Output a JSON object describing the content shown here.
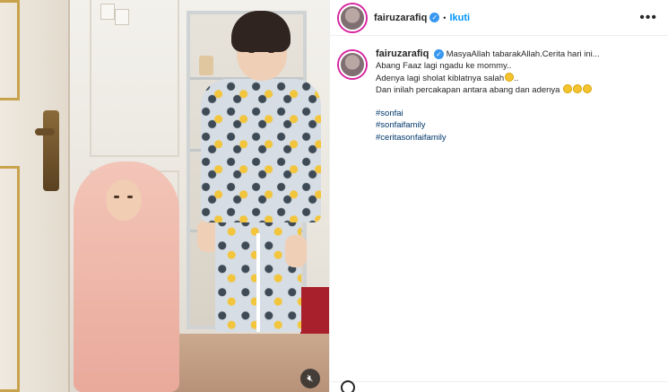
{
  "post": {
    "username": "fairuzarafiq",
    "separator": "•",
    "follow_label": "Ikuti",
    "more_label": "•••",
    "caption": {
      "username": "fairuzarafiq",
      "lines": [
        "MasyaAllah tabarakAllah.Cerita hari ini...",
        "Abang Faaz lagi ngadu ke mommy..",
        "Adenya lagi sholat kiblatnya salah",
        "Dan inilah percakapan antara abang dan adenya"
      ],
      "line3_suffix": "..",
      "hashtags": [
        "#sonfai",
        "#sonfaifamily",
        "#ceritasonfaifamily"
      ]
    }
  },
  "icons": {
    "verified": "verified-badge-icon",
    "more": "more-options-icon",
    "mute": "mute-icon",
    "like": "heart-icon"
  },
  "colors": {
    "link_blue": "#0095f6",
    "hashtag": "#00376b",
    "verified": "#3897f0",
    "text": "#262626"
  }
}
